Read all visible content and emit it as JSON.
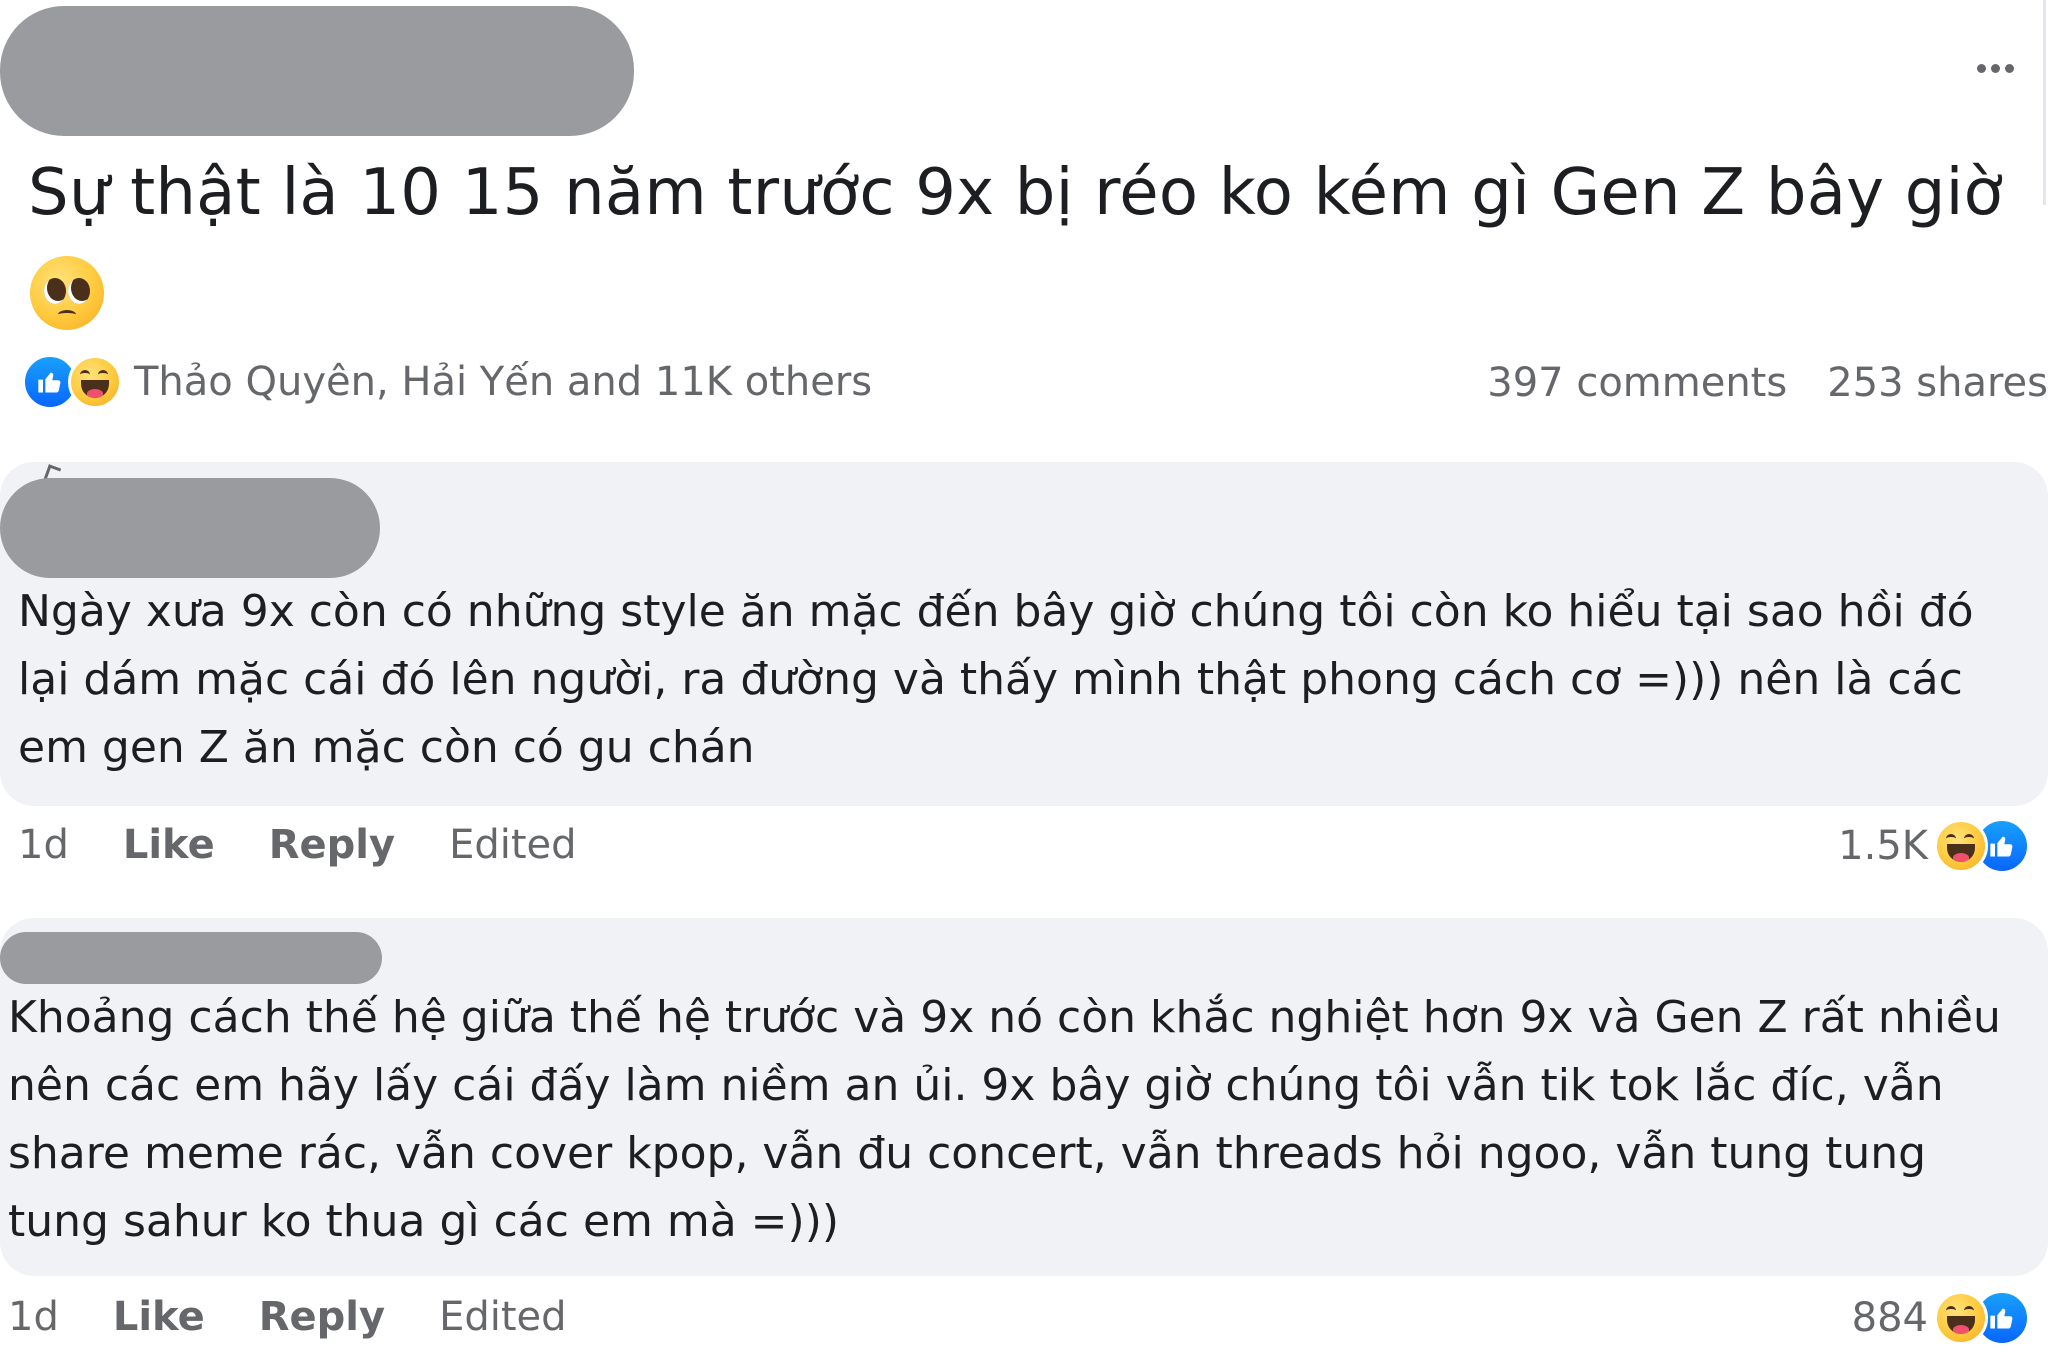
{
  "post": {
    "text": "Sự thật là 10 15 năm trước 9x bị réo ko kém gì Gen Z bây giờ",
    "emoji": "pleading-face",
    "reactions_summary": "Thảo Quyên, Hải Yến and 11K others",
    "comments_count": "397 comments",
    "shares_count": "253 shares"
  },
  "comments": [
    {
      "text": "Ngày xưa 9x còn có những style ăn mặc đến bây giờ chúng tôi còn ko hiểu tại sao hồi đó lại dám mặc cái đó lên người, ra đường và thấy mình thật phong cách cơ =))) nên là các em gen Z ăn mặc còn có gu chán",
      "age": "1d",
      "like_label": "Like",
      "reply_label": "Reply",
      "edited_label": "Edited",
      "reaction_count": "1.5K"
    },
    {
      "text": "Khoảng cách thế hệ giữa thế hệ trước và 9x nó còn khắc nghiệt hơn 9x và Gen Z rất nhiều nên các em hãy lấy cái đấy làm niềm an ủi. 9x bây giờ chúng tôi vẫn tik tok lắc đíc, vẫn share meme rác, vẫn cover kpop, vẫn đu concert, vẫn threads hỏi ngoo, vẫn tung tung tung sahur ko thua gì các em mà =)))",
      "age": "1d",
      "like_label": "Like",
      "reply_label": "Reply",
      "edited_label": "Edited",
      "reaction_count": "884"
    }
  ],
  "colors": {
    "bubble": "#f0f2f5",
    "redaction": "#9a9b9f",
    "secondary_text": "#65676b",
    "like_blue": "#0866ff"
  }
}
